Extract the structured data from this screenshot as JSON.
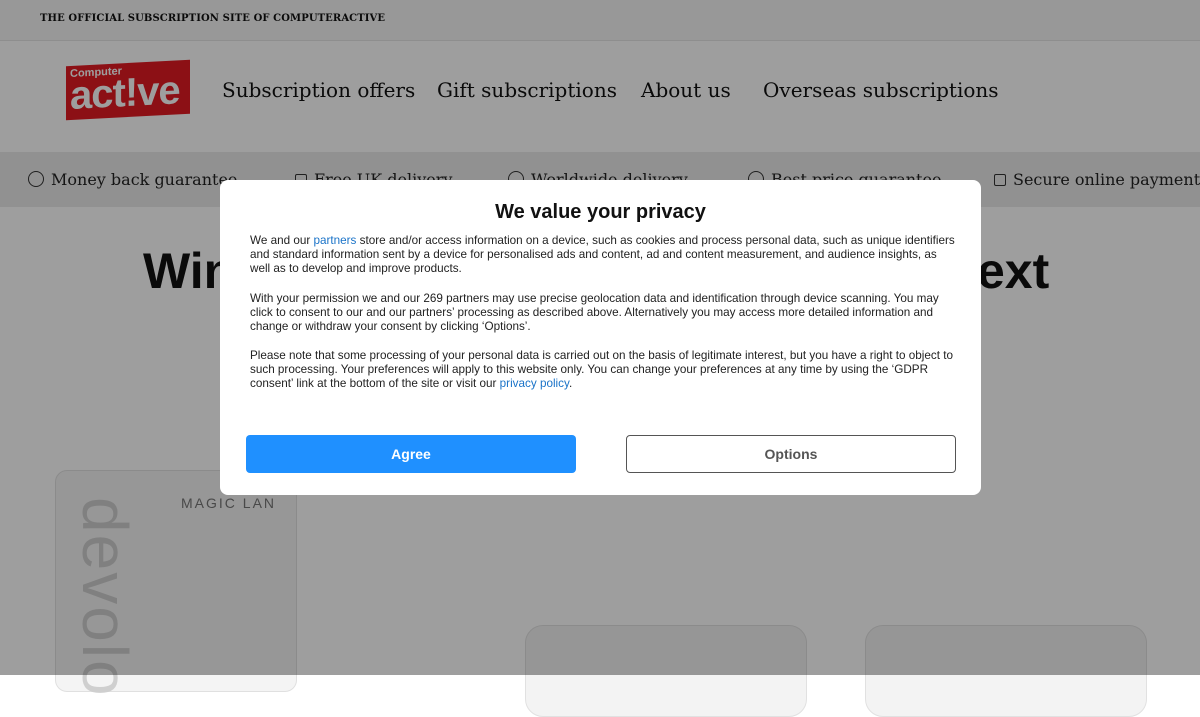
{
  "topbar": {
    "text": "THE OFFICIAL SUBSCRIPTION SITE OF COMPUTERACTIVE"
  },
  "logo": {
    "small": "Computer",
    "big": "act!ve"
  },
  "nav": [
    {
      "label": "Subscription offers"
    },
    {
      "label": "Gift subscriptions"
    },
    {
      "label": "About us"
    },
    {
      "label": "Overseas subscriptions"
    }
  ],
  "benefits": [
    {
      "label": "Money back guarantee",
      "icon": "check-circle-icon"
    },
    {
      "label": "Free UK delivery",
      "icon": "truck-icon"
    },
    {
      "label": "Worldwide delivery",
      "icon": "globe-icon"
    },
    {
      "label": "Best price guarantee",
      "icon": "check-circle-icon"
    },
    {
      "label": "Secure online payment",
      "icon": "lock-icon"
    }
  ],
  "headline": {
    "left": "Win",
    "right": "ext"
  },
  "product": {
    "brand": "MAGIC LAN",
    "vertical": "devolo"
  },
  "modal": {
    "title": "We value your privacy",
    "p1_before": "We and our ",
    "p1_link": "partners",
    "p1_after": " store and/or access information on a device, such as cookies and process personal data, such as unique identifiers and standard information sent by a device for personalised ads and content, ad and content measurement, and audience insights, as well as to develop and improve products.",
    "p2": "With your permission we and our 269 partners may use precise geolocation data and identification through device scanning. You may click to consent to our and our partners’ processing as described above. Alternatively you may access more detailed information and change or withdraw your consent by clicking ‘Options’.",
    "p3_before": "Please note that some processing of your personal data is carried out on the basis of legitimate interest, but you have a right to object to such processing. Your preferences will apply to this website only. You can change your preferences at any time by using the ‘GDPR consent’ link at the bottom of the site or visit our ",
    "p3_link": "privacy policy",
    "p3_after": ".",
    "agree_label": "Agree",
    "options_label": "Options"
  },
  "colors": {
    "agree": "#1f90ff",
    "link": "#1a73c8",
    "brand": "#e21b22"
  }
}
